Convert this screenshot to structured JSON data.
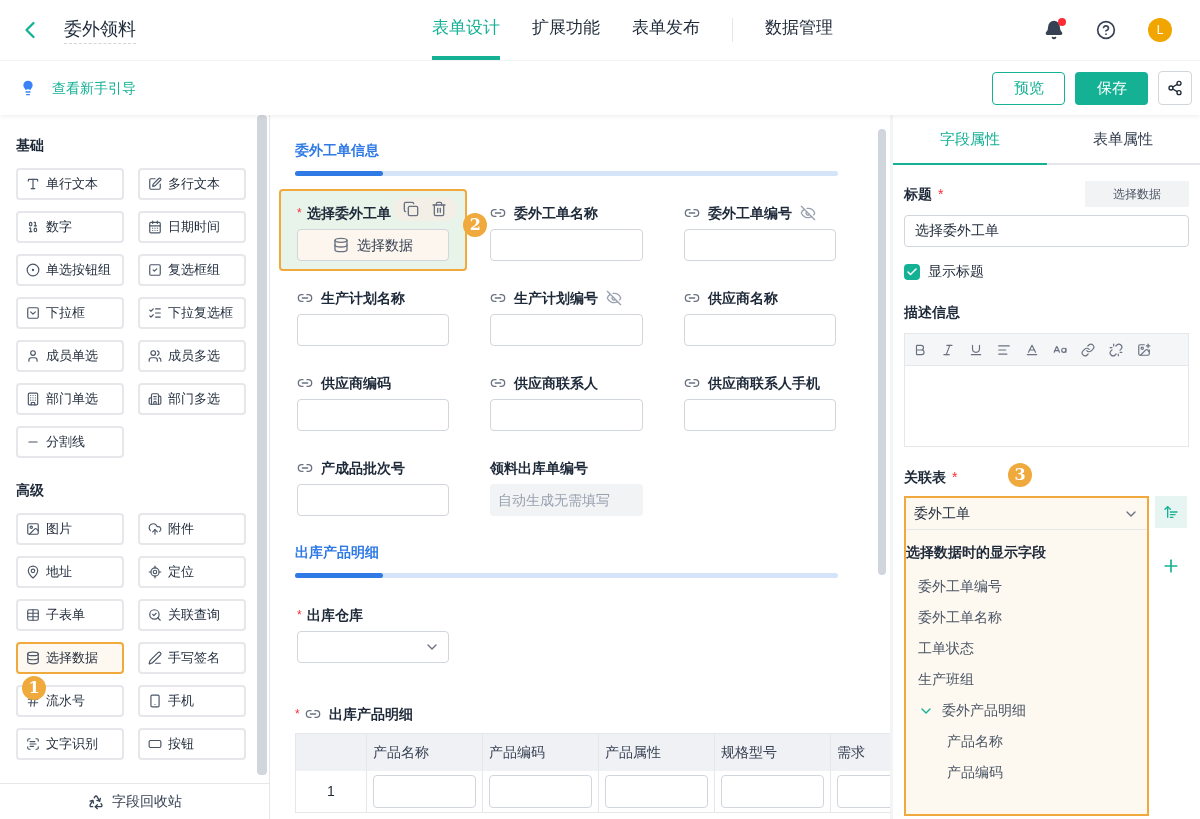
{
  "header": {
    "title": "委外领料",
    "tabs": [
      {
        "label": "表单设计",
        "selected": true
      },
      {
        "label": "扩展功能",
        "selected": false
      },
      {
        "label": "表单发布",
        "selected": false
      },
      {
        "label": "数据管理",
        "selected": false
      }
    ],
    "notification_dot": true,
    "avatar": "L"
  },
  "subbar": {
    "guide_link": "查看新手引导",
    "buttons": [
      {
        "label": "预览",
        "kind": "outline"
      },
      {
        "label": "保存",
        "kind": "primary"
      }
    ]
  },
  "palette": {
    "groups": [
      {
        "title": "基础",
        "items": [
          {
            "label": "单行文本",
            "selected": false
          },
          {
            "label": "多行文本",
            "selected": false
          },
          {
            "label": "数字",
            "selected": false
          },
          {
            "label": "日期时间",
            "selected": false
          },
          {
            "label": "单选按钮组",
            "selected": false
          },
          {
            "label": "复选框组",
            "selected": false
          },
          {
            "label": "下拉框",
            "selected": false
          },
          {
            "label": "下拉复选框",
            "selected": false
          },
          {
            "label": "成员单选",
            "selected": false
          },
          {
            "label": "成员多选",
            "selected": false
          },
          {
            "label": "部门单选",
            "selected": false
          },
          {
            "label": "部门多选",
            "selected": false
          },
          {
            "label": "分割线",
            "selected": false
          }
        ]
      },
      {
        "title": "高级",
        "items": [
          {
            "label": "图片",
            "selected": false
          },
          {
            "label": "附件",
            "selected": false
          },
          {
            "label": "地址",
            "selected": false
          },
          {
            "label": "定位",
            "selected": false
          },
          {
            "label": "子表单",
            "selected": false
          },
          {
            "label": "关联查询",
            "selected": false
          },
          {
            "label": "选择数据",
            "selected": true
          },
          {
            "label": "手写签名",
            "selected": false
          },
          {
            "label": "流水号",
            "selected": false
          },
          {
            "label": "手机",
            "selected": false
          },
          {
            "label": "文字识别",
            "selected": false
          },
          {
            "label": "按钮",
            "selected": false
          }
        ]
      }
    ],
    "recycle_bin": "字段回收站",
    "step_marker": "1"
  },
  "form": {
    "sections": [
      {
        "title": "委外工单信息",
        "fields": [
          {
            "label": "选择委外工单",
            "kind": "button",
            "required": true,
            "required_mark": "*",
            "linked": false,
            "hidden": false,
            "selected": true,
            "button": "选择数据",
            "step_marker": "2"
          },
          {
            "label": "委外工单名称",
            "kind": "text",
            "required": false,
            "linked": true,
            "hidden": false,
            "selected": false
          },
          {
            "label": "委外工单编号",
            "kind": "text",
            "required": false,
            "linked": true,
            "hidden": true,
            "selected": false
          },
          {
            "label": "生产计划名称",
            "kind": "text",
            "required": false,
            "linked": true,
            "hidden": false,
            "selected": false
          },
          {
            "label": "生产计划编号",
            "kind": "text",
            "required": false,
            "linked": true,
            "hidden": true,
            "selected": false
          },
          {
            "label": "供应商名称",
            "kind": "text",
            "required": false,
            "linked": true,
            "hidden": false,
            "selected": false
          },
          {
            "label": "供应商编码",
            "kind": "text",
            "required": false,
            "linked": true,
            "hidden": false,
            "selected": false
          },
          {
            "label": "供应商联系人",
            "kind": "text",
            "required": false,
            "linked": true,
            "hidden": false,
            "selected": false
          },
          {
            "label": "供应商联系人手机",
            "kind": "text",
            "required": false,
            "linked": true,
            "hidden": false,
            "selected": false
          },
          {
            "label": "产成品批次号",
            "kind": "text",
            "required": false,
            "linked": true,
            "hidden": false,
            "selected": false
          },
          {
            "label": "领料出库单编号",
            "kind": "auto",
            "required": false,
            "linked": false,
            "hidden": false,
            "selected": false,
            "placeholder": "自动生成无需填写"
          }
        ]
      },
      {
        "title": "出库产品明细",
        "fields": [
          {
            "label": "出库仓库",
            "kind": "select",
            "required": true,
            "required_mark": "*",
            "linked": false,
            "hidden": false,
            "selected": false
          }
        ]
      }
    ],
    "subform": {
      "label": "出库产品明细",
      "required": true,
      "required_mark": "*",
      "linked": true,
      "columns": [
        "产品名称",
        "产品编码",
        "产品属性",
        "规格型号",
        "需求"
      ],
      "rows": [
        {
          "index": "1"
        }
      ]
    }
  },
  "properties": {
    "tabs": [
      {
        "label": "字段属性",
        "selected": true
      },
      {
        "label": "表单属性",
        "selected": false
      }
    ],
    "title_label": "标题",
    "title_required": true,
    "title_required_mark": "*",
    "type_button": "选择数据",
    "title_value": "选择委外工单",
    "show_title": {
      "label": "显示标题",
      "checked": true
    },
    "description_label": "描述信息",
    "related_label": "关联表",
    "related_required": true,
    "related_required_mark": "*",
    "step_marker": "3",
    "related_value": "委外工单",
    "display_fields_label": "选择数据时的显示字段",
    "display_fields": [
      {
        "label": "委外工单编号"
      },
      {
        "label": "委外工单名称"
      },
      {
        "label": "工单状态"
      },
      {
        "label": "生产班组"
      },
      {
        "label": "委外产品明细",
        "expanded": true,
        "children": [
          {
            "label": "产品名称"
          },
          {
            "label": "产品编码"
          }
        ]
      }
    ]
  }
}
